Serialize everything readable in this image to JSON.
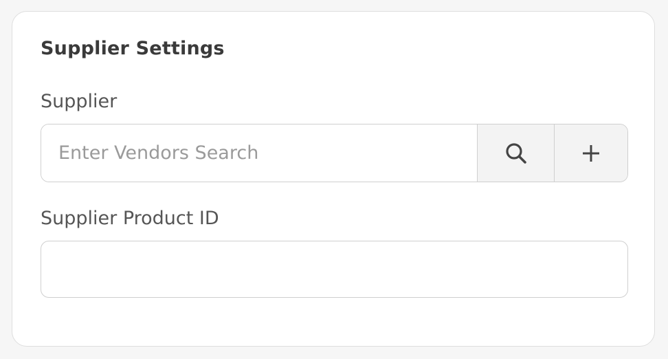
{
  "card": {
    "title": "Supplier Settings"
  },
  "supplier": {
    "label": "Supplier",
    "value": "",
    "placeholder": "Enter Vendors Search",
    "search_icon": "search-icon",
    "add_icon": "plus-icon"
  },
  "supplier_product_id": {
    "label": "Supplier Product ID",
    "value": "",
    "placeholder": ""
  },
  "colors": {
    "page_background": "#f6f6f6",
    "card_background": "#ffffff",
    "border": "#cfcfcf",
    "button_background": "#f3f3f3",
    "title_text": "#3a3a3a",
    "label_text": "#555555",
    "placeholder_text": "#9a9a9a"
  }
}
